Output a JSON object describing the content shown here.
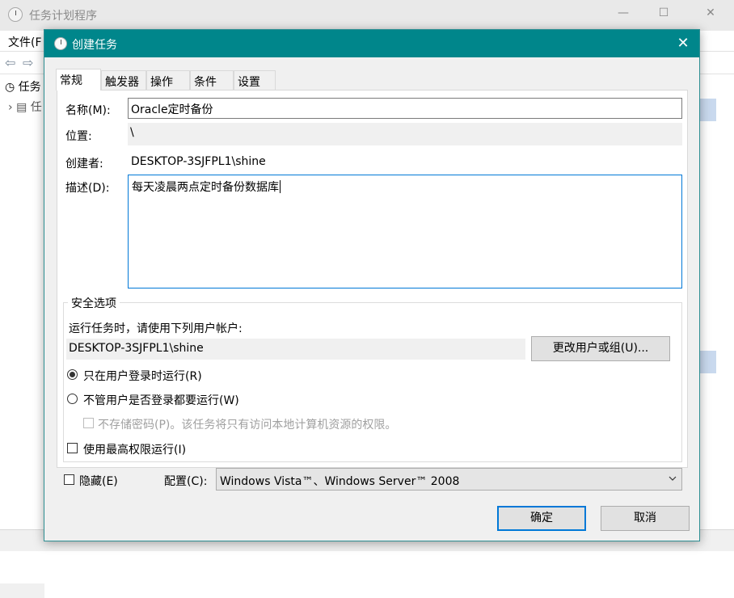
{
  "bg": {
    "title": "任务计划程序",
    "menu": "文件(F",
    "tree_root": "任务",
    "tree_child": "任"
  },
  "dialog": {
    "title": "创建任务",
    "tabs": [
      "常规",
      "触发器",
      "操作",
      "条件",
      "设置"
    ],
    "name_label": "名称(M):",
    "name_value": "Oracle定时备份",
    "location_label": "位置:",
    "location_value": "\\",
    "author_label": "创建者:",
    "author_value": "DESKTOP-3SJFPL1\\shine",
    "desc_label": "描述(D):",
    "desc_value": "每天凌晨两点定时备份数据库",
    "security": {
      "title": "安全选项",
      "run_as_label": "运行任务时，请使用下列用户帐户:",
      "user_value": "DESKTOP-3SJFPL1\\shine",
      "change_user_button": "更改用户或组(U)...",
      "radio_logged_on": "只在用户登录时运行(R)",
      "radio_any": "不管用户是否登录都要运行(W)",
      "no_store_password": "不存储密码(P)。该任务将只有访问本地计算机资源的权限。",
      "highest_privileges": "使用最高权限运行(I)"
    },
    "hidden_label": "隐藏(E)",
    "config_label": "配置(C):",
    "config_value": "Windows Vista™、Windows Server™ 2008",
    "ok_button": "确定",
    "cancel_button": "取消"
  }
}
